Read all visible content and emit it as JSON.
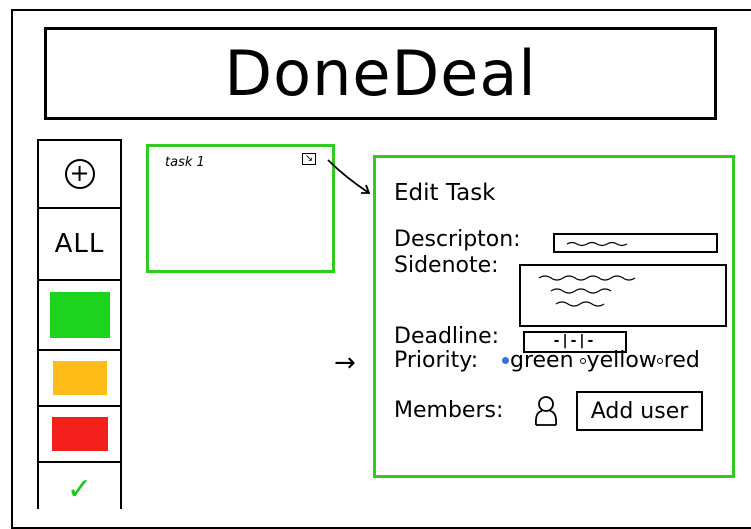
{
  "app": {
    "title": "DoneDeal"
  },
  "sidebar": {
    "add_icon": "plus-circle-icon",
    "all_label": "ALL",
    "filters": [
      {
        "name": "green",
        "color": "#1ed31e"
      },
      {
        "name": "yellow",
        "color": "#ffbd1a"
      },
      {
        "name": "red",
        "color": "#f4201b"
      }
    ],
    "done_icon": "checkmark-icon",
    "done_color": "#1bc41b"
  },
  "task_card": {
    "title": "task 1",
    "edit_icon": "edit-icon",
    "border_color": "#2fcc1f"
  },
  "edit_task": {
    "title": "Edit Task",
    "description_label": "Descripton:",
    "sidenote_label": "Sidenote:",
    "deadline_label": "Deadline:",
    "deadline_value": "-|-|-",
    "priority_label": "Priority:",
    "priority_options": [
      "green",
      "yellow",
      "red"
    ],
    "priority_selected": "green",
    "members_label": "Members:",
    "member_icon": "user-icon",
    "add_user_label": "Add user"
  }
}
